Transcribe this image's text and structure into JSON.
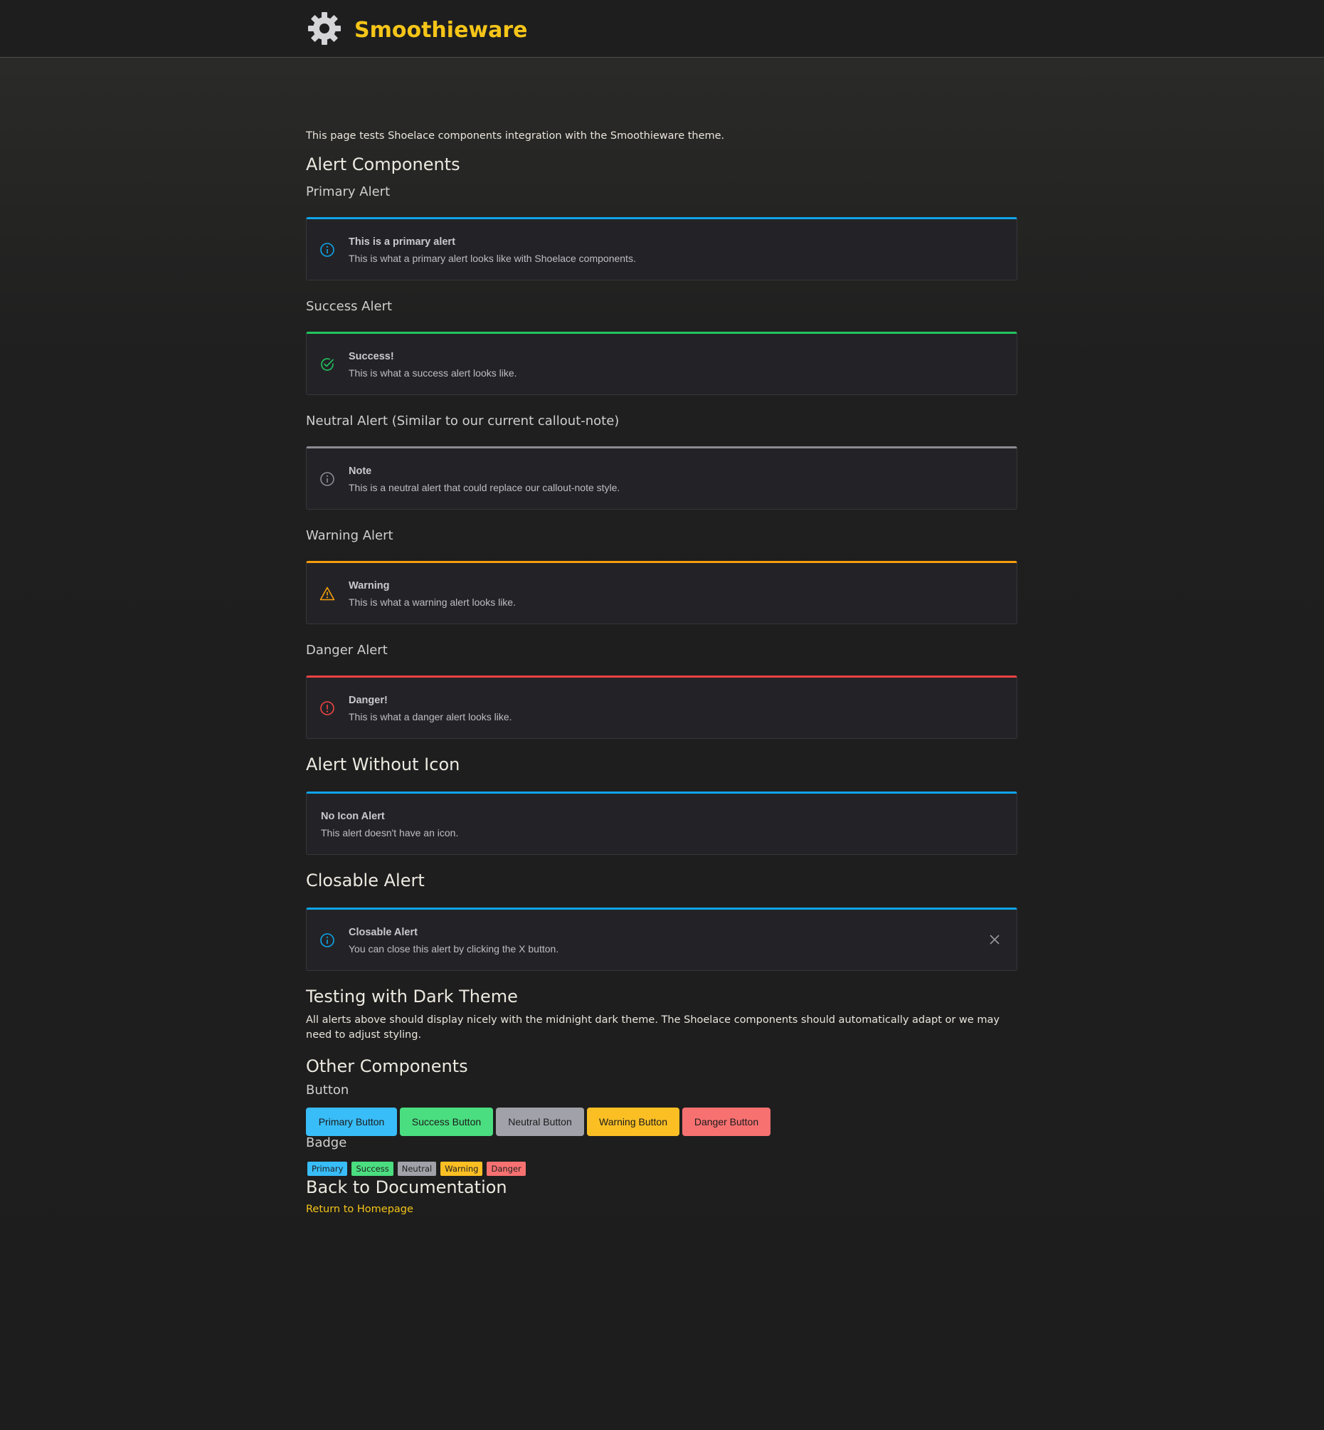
{
  "header": {
    "brand": "Smoothieware",
    "logo_icon": "gear-icon"
  },
  "intro": "This page tests Shoelace components integration with the Smoothieware theme.",
  "sections": {
    "alert_components": "Alert Components",
    "alert_without_icon": "Alert Without Icon",
    "closable_alert": "Closable Alert",
    "testing": "Testing with Dark Theme",
    "other": "Other Components",
    "back": "Back to Documentation"
  },
  "alerts": [
    {
      "heading": "Primary Alert",
      "title": "This is a primary alert",
      "message": "This is what a primary alert looks like with Shoelace components.",
      "color": "#0ea5e9",
      "icon": "info-circle-icon"
    },
    {
      "heading": "Success Alert",
      "title": "Success!",
      "message": "This is what a success alert looks like.",
      "color": "#22c55e",
      "icon": "check-circle-icon"
    },
    {
      "heading": "Neutral Alert (Similar to our current callout-note)",
      "title": "Note",
      "message": "This is a neutral alert that could replace our callout-note style.",
      "color": "#8b8b93",
      "icon": "info-circle-icon"
    },
    {
      "heading": "Warning Alert",
      "title": "Warning",
      "message": "This is what a warning alert looks like.",
      "color": "#f59e0b",
      "icon": "warning-triangle-icon"
    },
    {
      "heading": "Danger Alert",
      "title": "Danger!",
      "message": "This is what a danger alert looks like.",
      "color": "#ef4444",
      "icon": "exclamation-circle-icon"
    }
  ],
  "no_icon_alert": {
    "title": "No Icon Alert",
    "message": "This alert doesn't have an icon.",
    "color": "#0ea5e9"
  },
  "closable": {
    "title": "Closable Alert",
    "message": "You can close this alert by clicking the X button.",
    "color": "#0ea5e9",
    "icon": "info-circle-icon",
    "close_icon": "close-icon"
  },
  "testing_text": "All alerts above should display nicely with the midnight dark theme. The Shoelace components should automatically adapt or we may need to adjust styling.",
  "button_heading": "Button",
  "buttons": [
    {
      "label": "Primary Button",
      "color": "#38bdf8"
    },
    {
      "label": "Success Button",
      "color": "#4ade80"
    },
    {
      "label": "Neutral Button",
      "color": "#a1a1aa"
    },
    {
      "label": "Warning Button",
      "color": "#fbbf24"
    },
    {
      "label": "Danger Button",
      "color": "#f87171"
    }
  ],
  "badge_heading": "Badge",
  "badges": [
    {
      "label": "Primary",
      "color": "#38bdf8"
    },
    {
      "label": "Success",
      "color": "#4ade80"
    },
    {
      "label": "Neutral",
      "color": "#a1a1aa"
    },
    {
      "label": "Warning",
      "color": "#fbbf24"
    },
    {
      "label": "Danger",
      "color": "#f87171"
    }
  ],
  "back_link": "Return to Homepage"
}
